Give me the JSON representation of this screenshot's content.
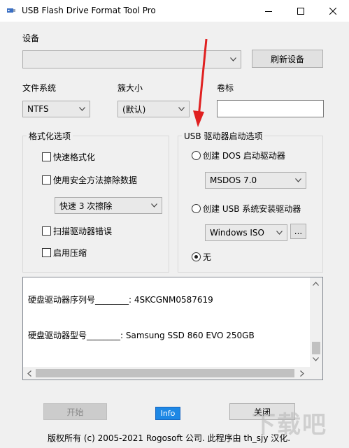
{
  "window": {
    "title": "USB Flash Drive Format Tool Pro",
    "minimize_glyph": "—",
    "maximize_glyph": "☐",
    "close_glyph": "✕"
  },
  "device": {
    "label": "设备",
    "selected": "",
    "refresh_label": "刷新设备"
  },
  "filesystem": {
    "label": "文件系统",
    "selected": "NTFS"
  },
  "cluster": {
    "label": "簇大小",
    "selected": "(默认)"
  },
  "volume": {
    "label": "卷标",
    "value": ""
  },
  "format_options": {
    "title": "格式化选项",
    "quick_format": "快速格式化",
    "secure_wipe": "使用安全方法擦除数据",
    "wipe_method": "快速 3 次擦除",
    "scan_errors": "扫描驱动器错误",
    "compression": "启用压缩"
  },
  "boot_options": {
    "title": "USB 驱动器启动选项",
    "dos_label": "创建 DOS 启动驱动器",
    "dos_version": "MSDOS 7.0",
    "usb_install_label": "创建 USB 系统安装驱动器",
    "iso_type": "Windows ISO",
    "browse_label": "...",
    "none_label": "无",
    "selected": "none"
  },
  "info": {
    "serial_line": "硬盘驱动器序列号________: 4SKCGNM0587619",
    "model_line": "硬盘驱动器型号________: Samsung SSD 860 EVO 250GB"
  },
  "buttons": {
    "start": "开始",
    "info": "Info",
    "close": "关闭"
  },
  "footer": {
    "copyright": "版权所有 (c) 2005-2021 Rogosoft 公司.   此程序由 th_sjy 汉化."
  },
  "watermark": "下载吧",
  "annotation_color": "#e02020",
  "icons": [
    "usb-app-icon",
    "chevron-down-icon",
    "red-arrow-annotation"
  ]
}
